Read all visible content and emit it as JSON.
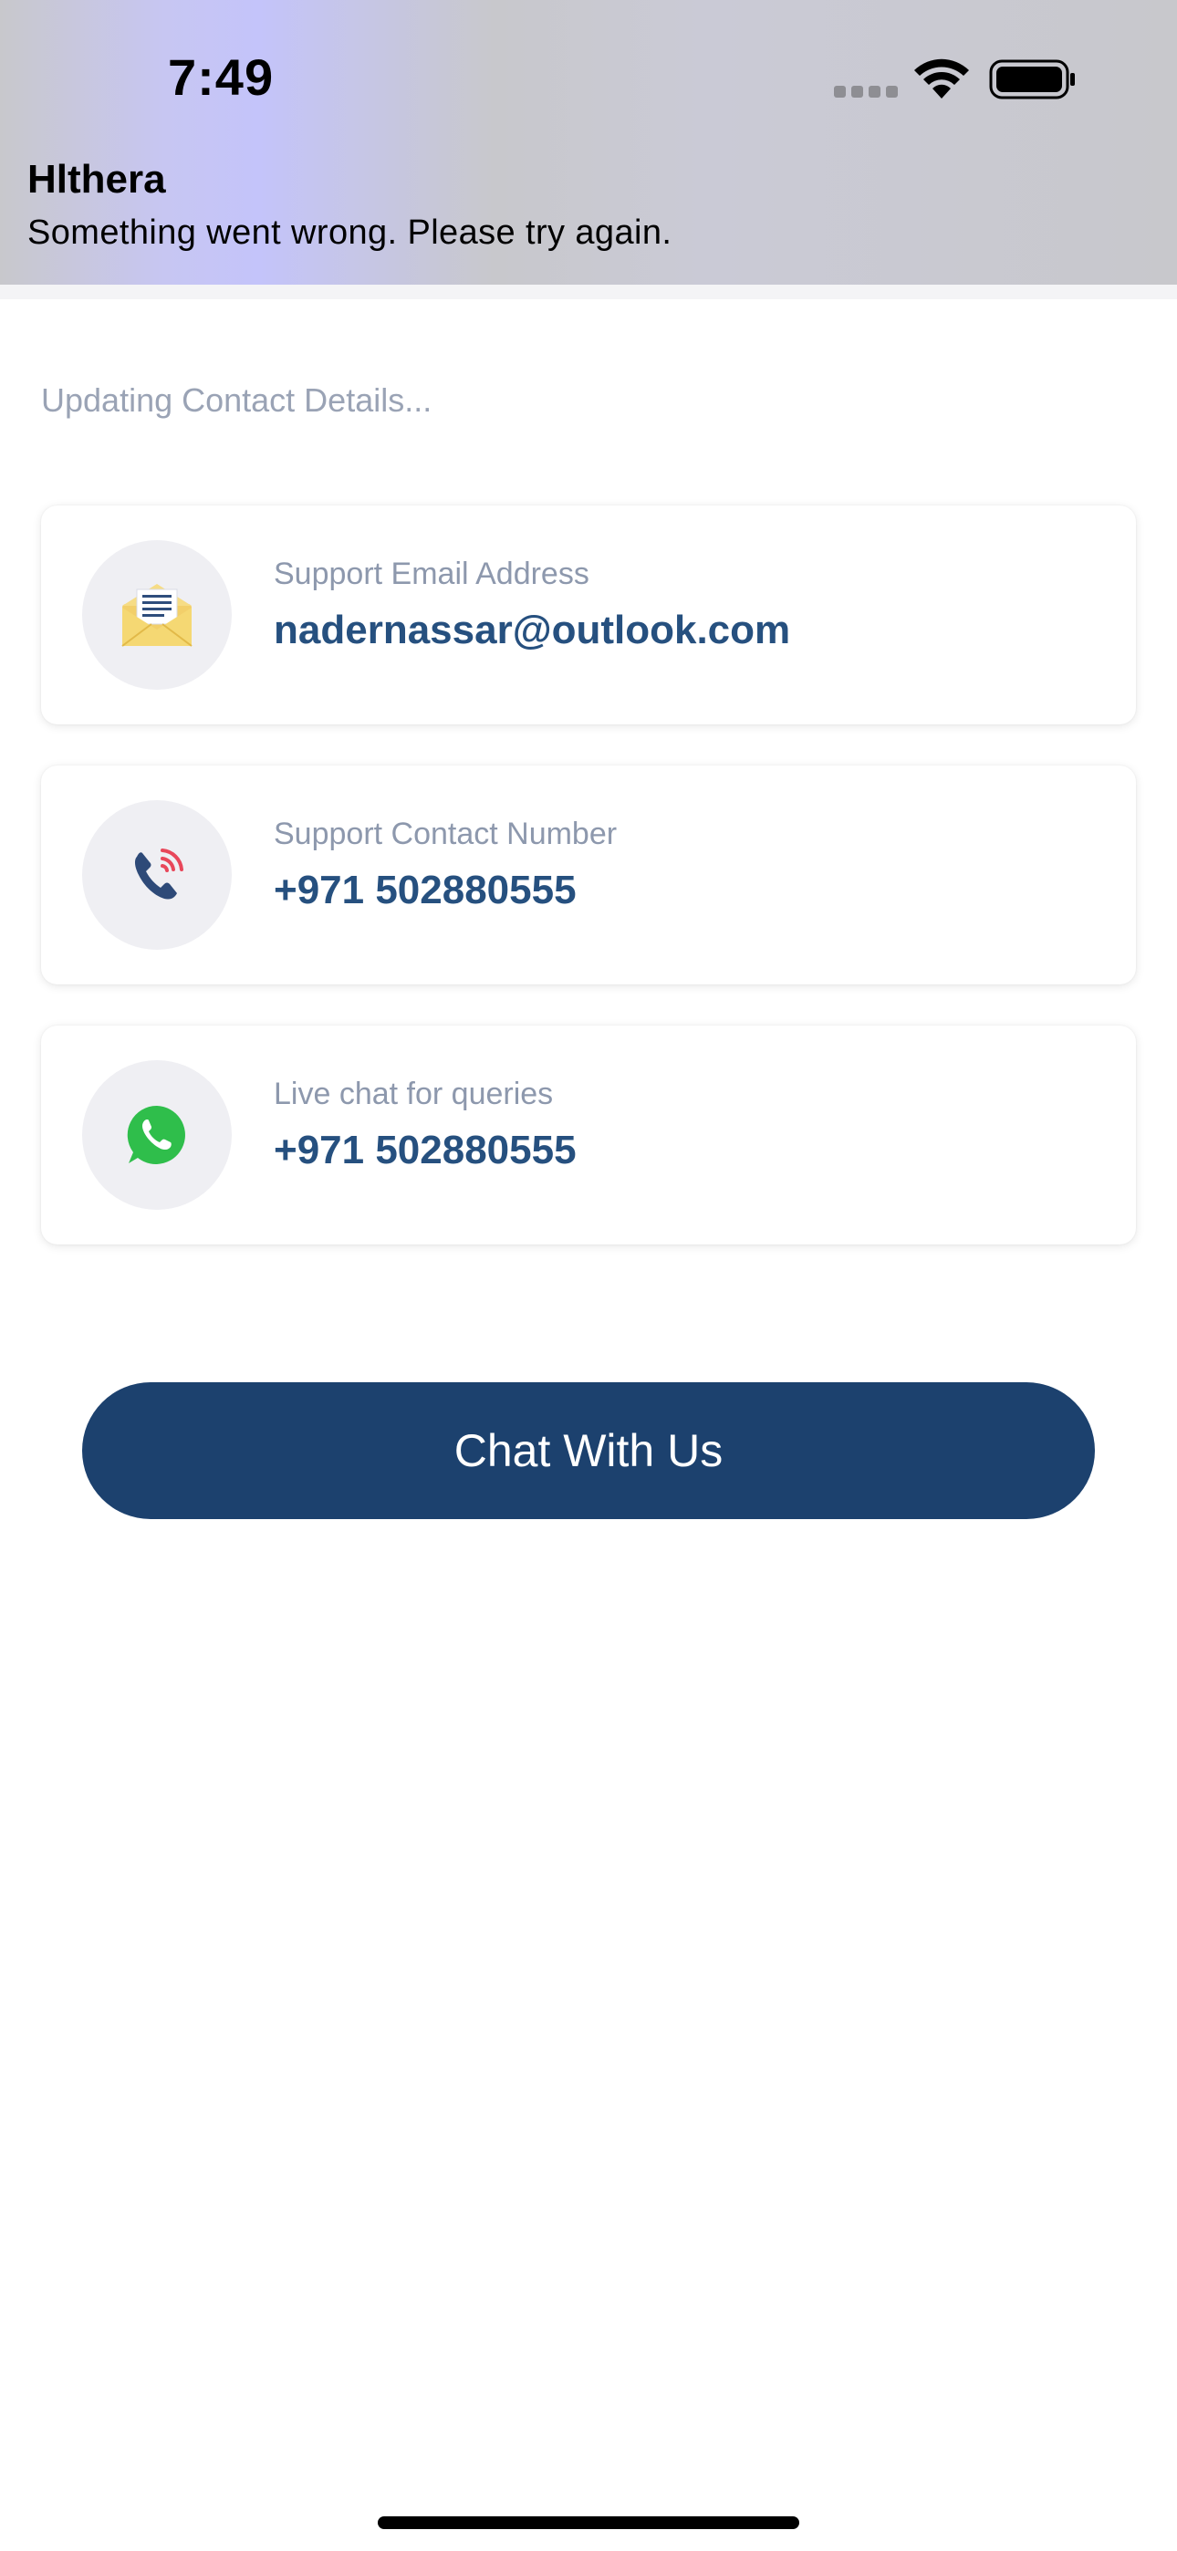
{
  "status_bar": {
    "time": "7:49"
  },
  "notification": {
    "app_name": "Hlthera",
    "message": "Something went wrong. Please try again."
  },
  "main": {
    "status_text": "Updating Contact Details...",
    "cards": [
      {
        "icon": "envelope-icon",
        "label": "Support Email Address",
        "value": "nadernassar@outlook.com"
      },
      {
        "icon": "phone-icon",
        "label": "Support Contact Number",
        "value": "+971 502880555"
      },
      {
        "icon": "whatsapp-icon",
        "label": "Live chat for queries",
        "value": "+971 502880555"
      }
    ],
    "chat_button_label": "Chat With Us"
  },
  "colors": {
    "accent": "#1c416e",
    "value_text": "#26507f",
    "label_text": "#8d98ad",
    "whatsapp_green": "#2fbe4b"
  }
}
